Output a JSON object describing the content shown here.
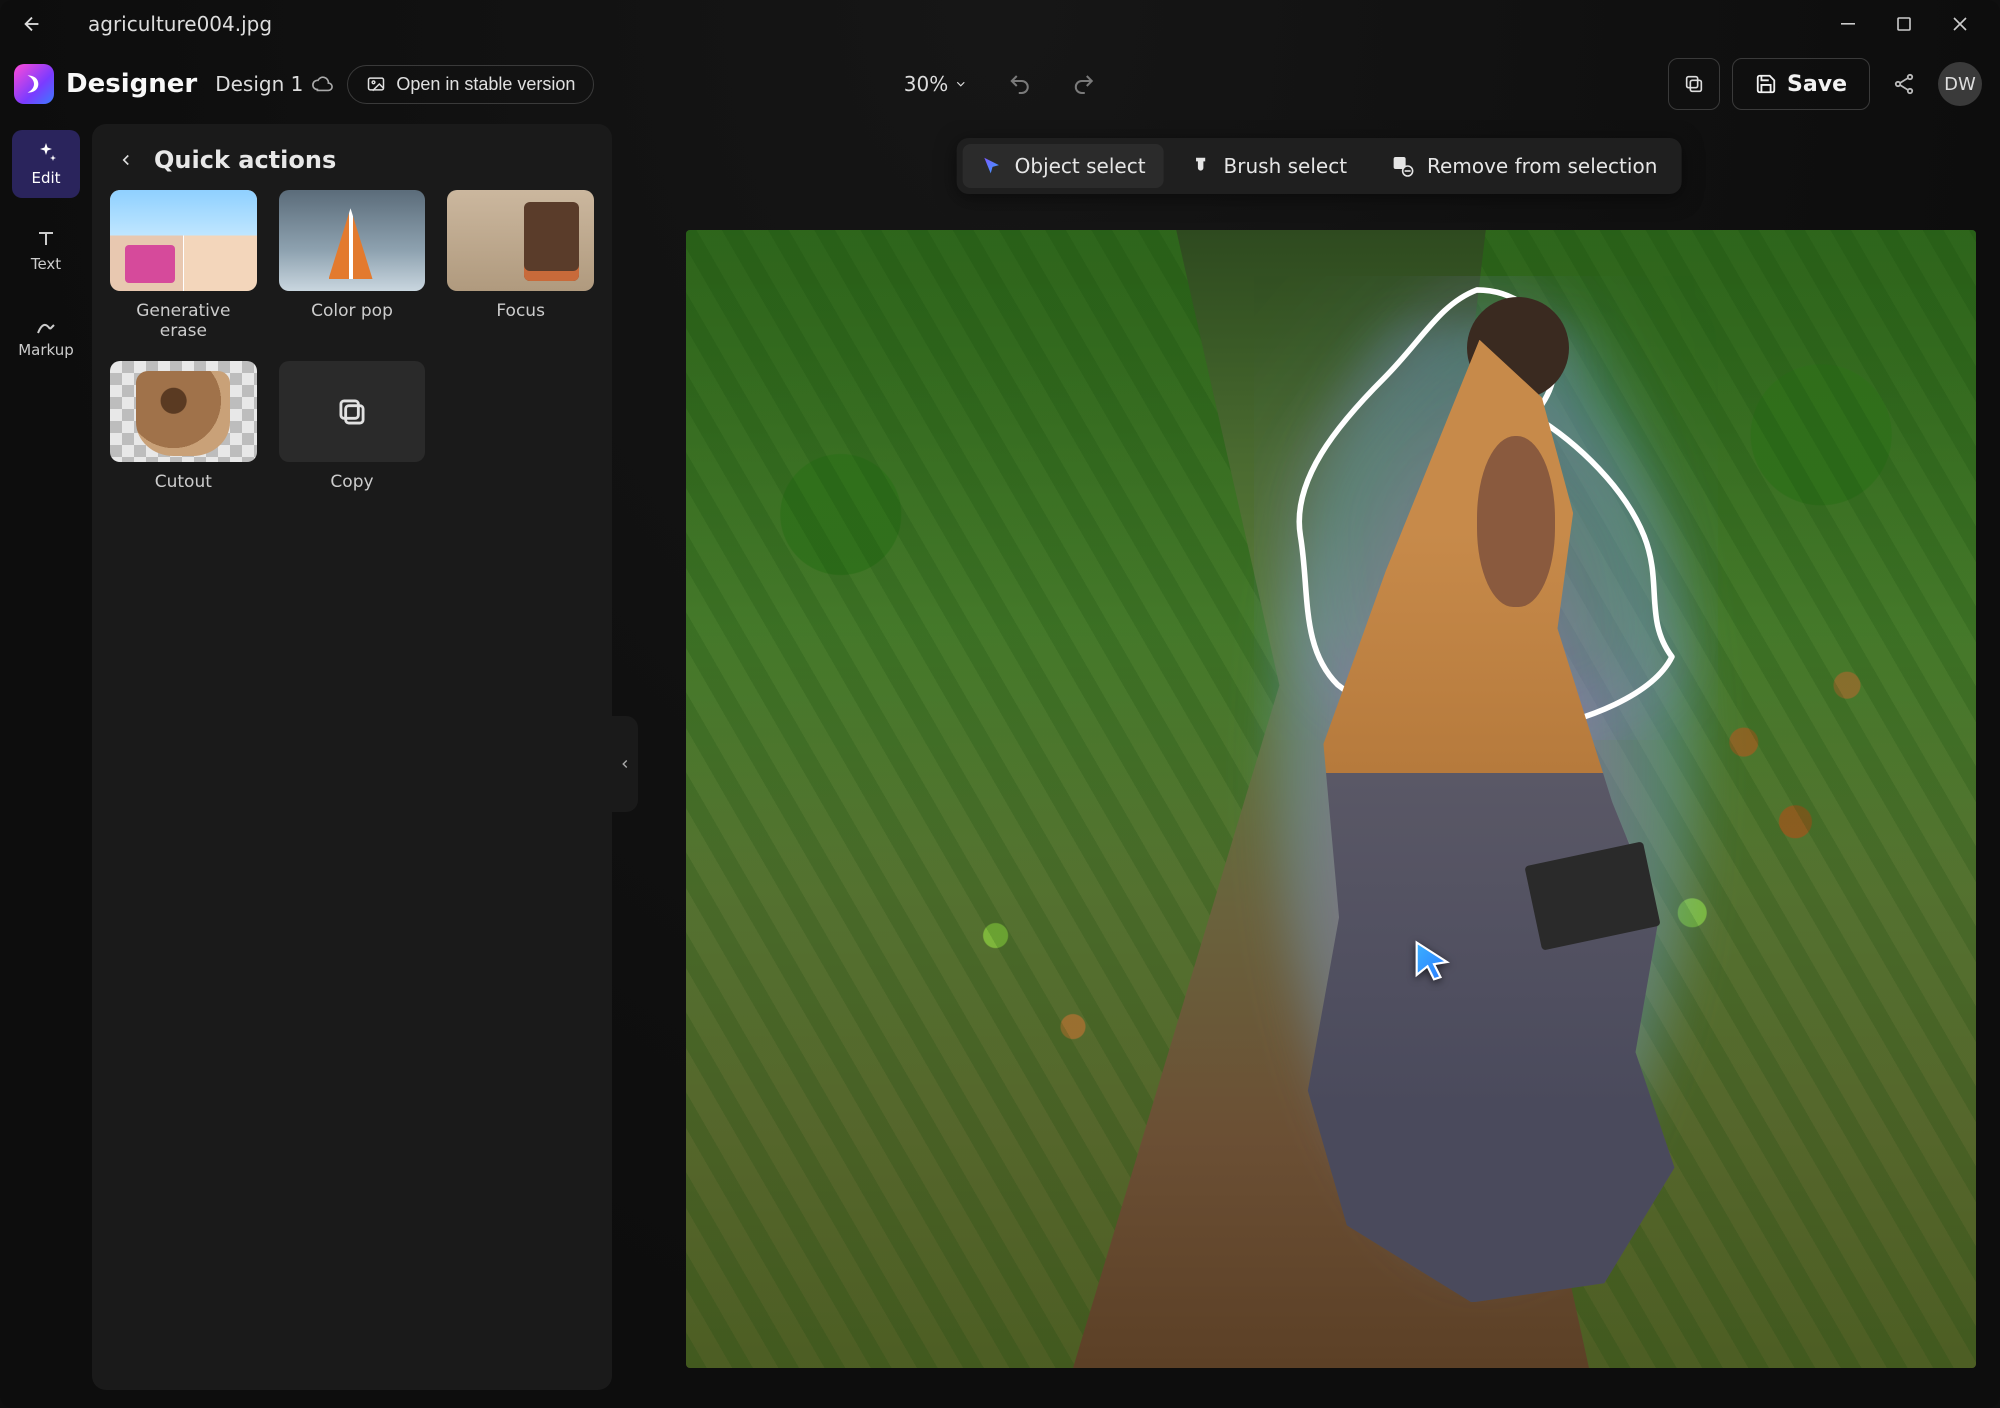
{
  "window": {
    "filename": "agriculture004.jpg",
    "min": "–",
    "restore": "❐",
    "close": "✕"
  },
  "header": {
    "app_name": "Designer",
    "design_title": "Design 1",
    "open_stable": "Open in stable version",
    "zoom": "30%",
    "save": "Save",
    "avatar": "DW"
  },
  "rail": {
    "edit": "Edit",
    "text": "Text",
    "markup": "Markup"
  },
  "panel": {
    "title": "Quick actions",
    "items": [
      {
        "label": "Generative erase"
      },
      {
        "label": "Color pop"
      },
      {
        "label": "Focus"
      },
      {
        "label": "Cutout"
      },
      {
        "label": "Copy"
      }
    ]
  },
  "selection_toolbar": {
    "object_select": "Object select",
    "brush_select": "Brush select",
    "remove": "Remove from selection"
  }
}
